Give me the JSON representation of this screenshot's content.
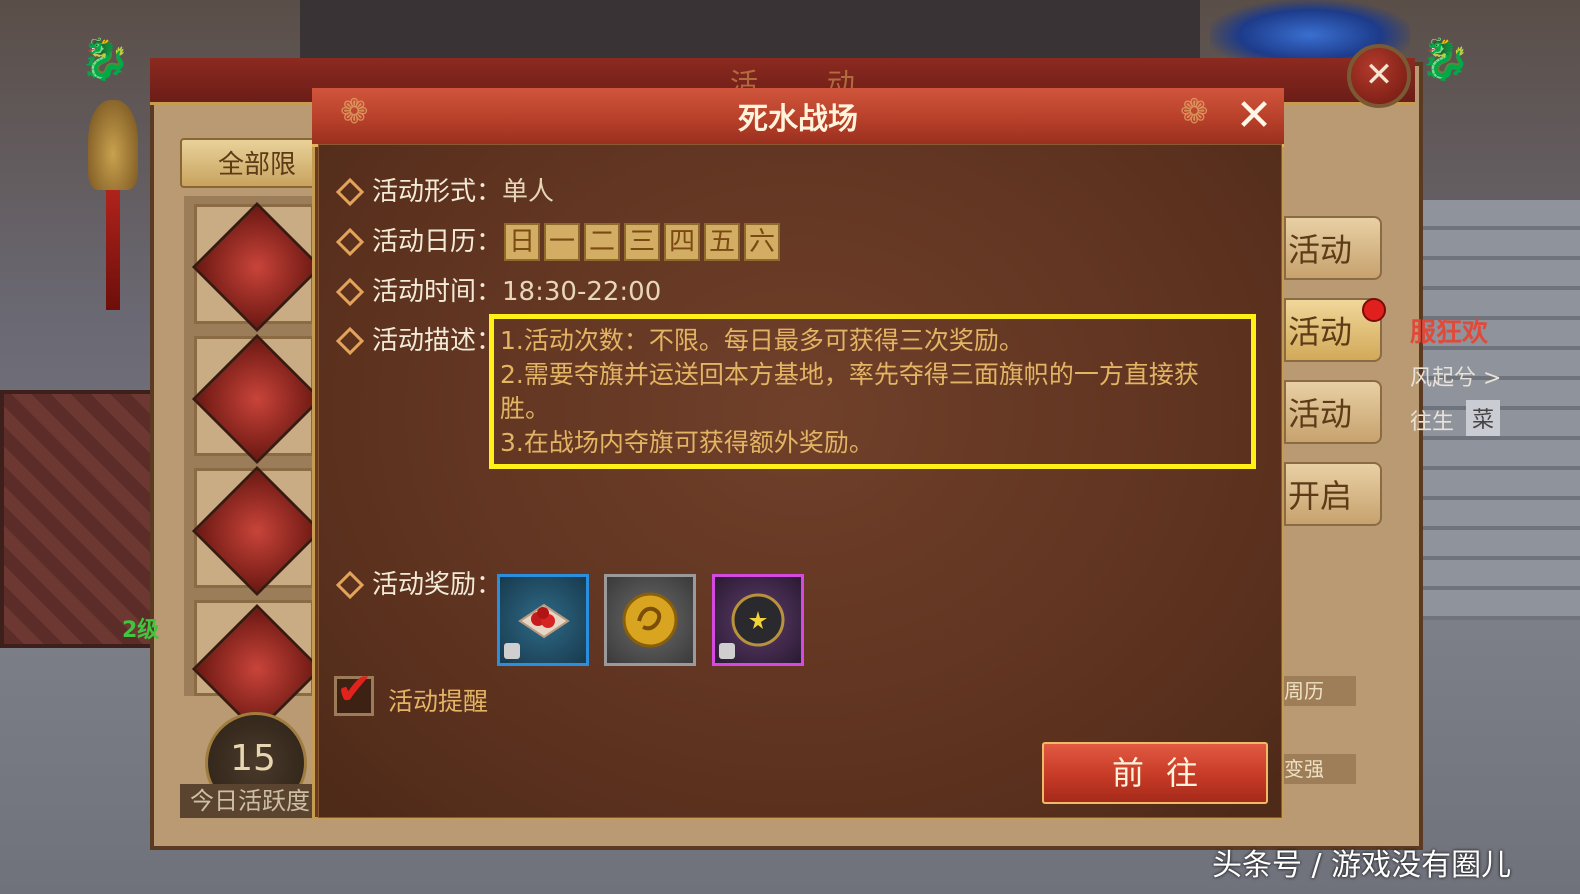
{
  "outer_panel": {
    "title": "活 动",
    "close_glyph": "✕",
    "tab_all_label": "全部限时",
    "side_buttons": [
      "活动",
      "活动",
      "活动",
      "开启"
    ],
    "side_links": [
      "周历",
      "变强"
    ],
    "activity_score": "15",
    "activity_score_label": "今日活跃度",
    "level_tag": "2级"
  },
  "background": {
    "promo_text": "服狂欢",
    "promo_sub": "风起兮 >",
    "promo_sub2": "往生",
    "promo_btn": "菜"
  },
  "dialog": {
    "title": "死水战场",
    "close_glyph": "✕",
    "form_label": "活动形式：",
    "form_value": "单人",
    "calendar_label": "活动日历：",
    "calendar_days": [
      "日",
      "一",
      "二",
      "三",
      "四",
      "五",
      "六"
    ],
    "time_label": "活动时间：",
    "time_value": "18:30-22:00",
    "desc_label": "活动描述：",
    "desc_lines": [
      "1.活动次数：不限。每日最多可获得三次奖励。",
      "2.需要夺旗并运送回本方基地，率先夺得三面旗帜的一方直接获",
      "胜。",
      "3.在战场内夺旗可获得额外奖励。"
    ],
    "reward_label": "活动奖励：",
    "rewards": [
      {
        "name": "red-berries-item",
        "frame": "blue",
        "locked": true
      },
      {
        "name": "gold-coin-item",
        "frame": "grey",
        "locked": false
      },
      {
        "name": "dark-orb-item",
        "frame": "purple",
        "locked": true
      }
    ],
    "reminder_label": "活动提醒",
    "reminder_checked": true,
    "go_button": "前往"
  },
  "watermark": "头条号 / 游戏没有圈儿",
  "colors": {
    "highlight_box": "#fff016",
    "desc_text": "#e3b463",
    "dialog_header": "#c0442c",
    "go_button": "#c63a26"
  }
}
